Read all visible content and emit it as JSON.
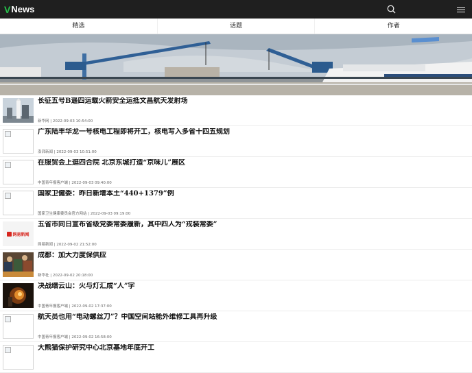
{
  "app": {
    "brand_v": "V",
    "brand_name": "News"
  },
  "tabs": [
    {
      "label": "精选"
    },
    {
      "label": "话题"
    },
    {
      "label": "作者"
    }
  ],
  "news": [
    {
      "title": "长征五号B遥四运载火箭安全运抵文昌航天发射场",
      "meta": "新华网 | 2022-09-03 10:54:00",
      "thumb": "rocket-photo"
    },
    {
      "title": "广东陆丰华龙一号核电工程即将开工，核电写入多省十四五规划",
      "meta": "澎湃新闻 | 2022-09-03 10:51:00",
      "thumb": "broken"
    },
    {
      "title": "在服贸会上逛四合院 北京东城打造“京味儿”展区",
      "meta": "中国青年报客户端 | 2022-09-03 09:40:00",
      "thumb": "broken"
    },
    {
      "title": "国家卫健委：昨日新增本土“440+1379”例",
      "meta": "国家卫生健康委员会官方网站 | 2022-09-03 09:19:00",
      "thumb": "broken"
    },
    {
      "title": "五省市同日宣布省级党委常委履新，其中四人为“戎装常委”",
      "meta": "网易新闻 | 2022-09-02 21:52:00",
      "thumb": "netease",
      "thumb_label": "网易新闻"
    },
    {
      "title": "成都：加大力度保供应",
      "meta": "新华社 | 2022-09-02 20:18:00",
      "thumb": "market-photo"
    },
    {
      "title": "决战缙云山：火与灯汇成“人”字",
      "meta": "中国青年报客户端 | 2022-09-02 17:37:00",
      "thumb": "fire-photo"
    },
    {
      "title": "航天员也用“电动螺丝刀”？中国空间站舱外维修工具再升级",
      "meta": "中国青年报客户端 | 2022-09-02 16:58:00",
      "thumb": "broken"
    },
    {
      "title": "大熊猫保护研究中心北京基地年底开工",
      "meta": "",
      "thumb": "broken"
    }
  ],
  "colors": {
    "topbar": "#1f1f1f",
    "brand_accent": "#27c24c",
    "netease_red": "#d7261e"
  },
  "icons": {
    "search": "search-icon",
    "menu": "menu-icon"
  }
}
